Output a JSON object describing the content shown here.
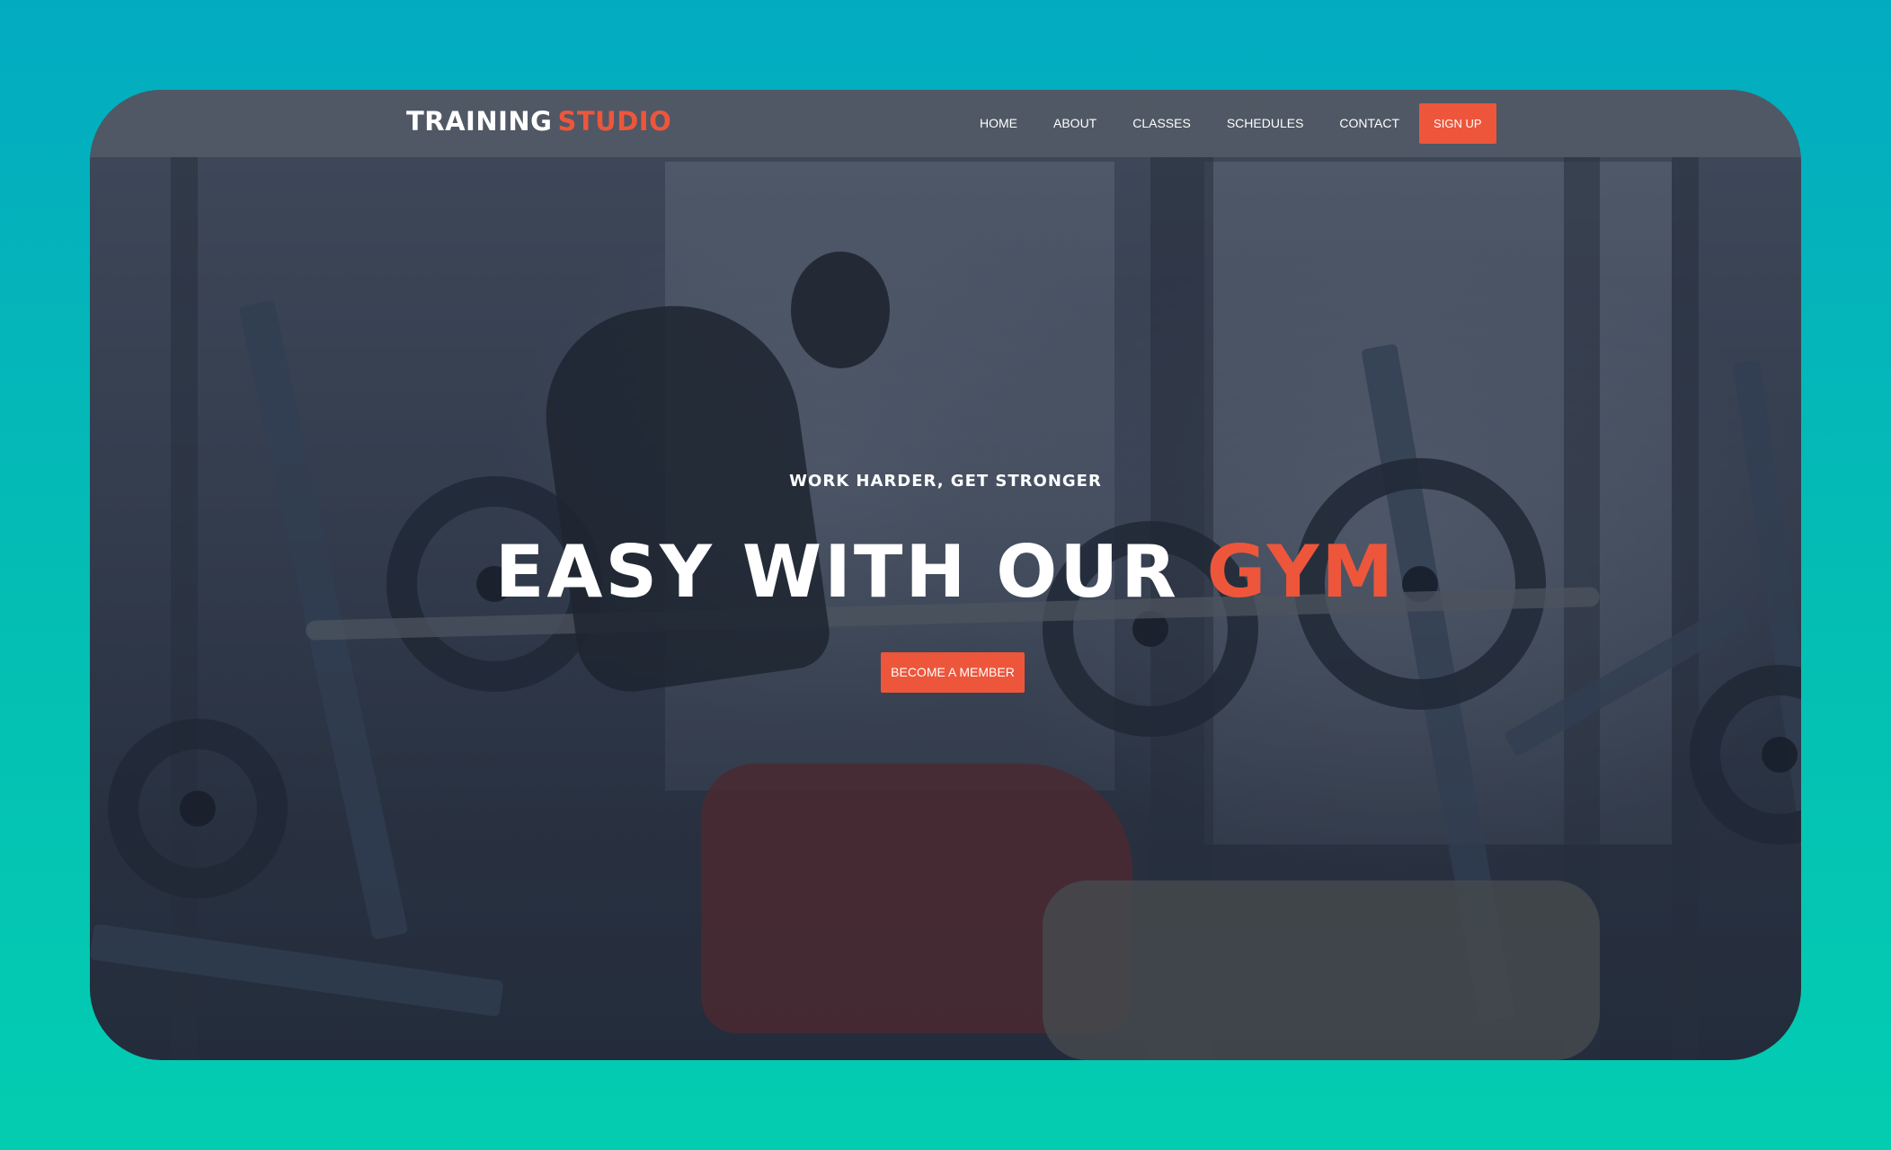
{
  "brand": {
    "part1": "TRAINING",
    "part2": "STUDIO"
  },
  "nav": {
    "items": [
      "HOME",
      "ABOUT",
      "CLASSES",
      "SCHEDULES",
      "CONTACT"
    ],
    "signup_label": "SIGN UP"
  },
  "hero": {
    "tagline": "WORK HARDER, GET STRONGER",
    "headline_main": "EASY WITH OUR",
    "headline_accent": "GYM",
    "cta_label": "BECOME A MEMBER"
  },
  "colors": {
    "accent": "#ed563b",
    "background_gradient_top": "#03abc1",
    "background_gradient_bottom": "#03cdb1",
    "text": "#ffffff"
  }
}
